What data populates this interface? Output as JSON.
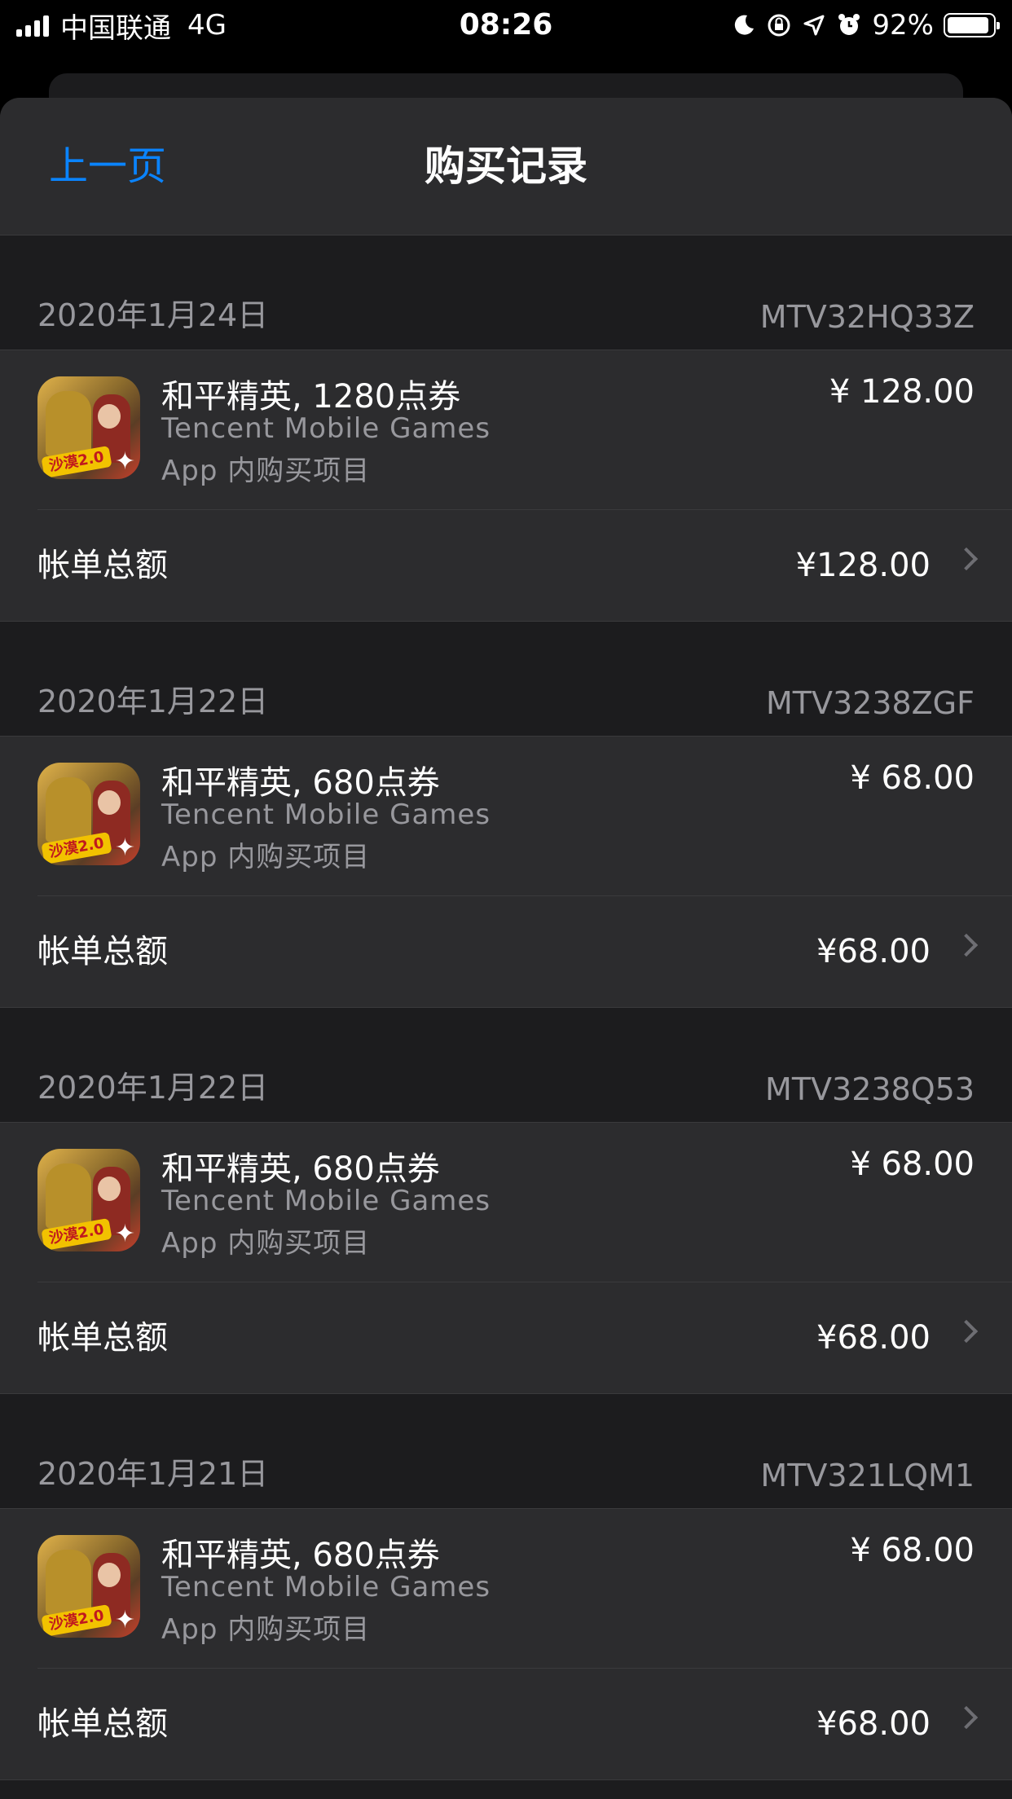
{
  "status_bar": {
    "carrier": "中国联通",
    "network": "4G",
    "time": "08:26",
    "battery_percent_label": "92%",
    "battery_level": 0.92,
    "icons": [
      "signal-icon",
      "moon-icon",
      "rotation-lock-icon",
      "location-icon",
      "alarm-icon",
      "battery-icon"
    ]
  },
  "nav": {
    "back_label": "上一页",
    "title": "购买记录"
  },
  "groups": [
    {
      "date": "2020年1月24日",
      "order_id": "MTV32HQ33Z",
      "item": {
        "name": "和平精英, 1280点券",
        "developer": "Tencent Mobile Games",
        "type": "App 内购买项目",
        "price": "¥ 128.00",
        "icon": "game-app-icon"
      },
      "total_label": "帐单总额",
      "total_value": "¥128.00"
    },
    {
      "date": "2020年1月22日",
      "order_id": "MTV3238ZGF",
      "item": {
        "name": "和平精英, 680点券",
        "developer": "Tencent Mobile Games",
        "type": "App 内购买项目",
        "price": "¥ 68.00",
        "icon": "game-app-icon"
      },
      "total_label": "帐单总额",
      "total_value": "¥68.00"
    },
    {
      "date": "2020年1月22日",
      "order_id": "MTV3238Q53",
      "item": {
        "name": "和平精英, 680点券",
        "developer": "Tencent Mobile Games",
        "type": "App 内购买项目",
        "price": "¥ 68.00",
        "icon": "game-app-icon"
      },
      "total_label": "帐单总额",
      "total_value": "¥68.00"
    },
    {
      "date": "2020年1月21日",
      "order_id": "MTV321LQM1",
      "item": {
        "name": "和平精英, 680点券",
        "developer": "Tencent Mobile Games",
        "type": "App 内购买项目",
        "price": "¥ 68.00",
        "icon": "game-app-icon"
      },
      "total_label": "帐单总额",
      "total_value": "¥68.00"
    }
  ],
  "app_icon_text": "沙漠2.0",
  "colors": {
    "accent": "#0a84ff",
    "background": "#1c1c1e",
    "cell": "#2c2c2e",
    "secondary_text": "#98989d"
  }
}
